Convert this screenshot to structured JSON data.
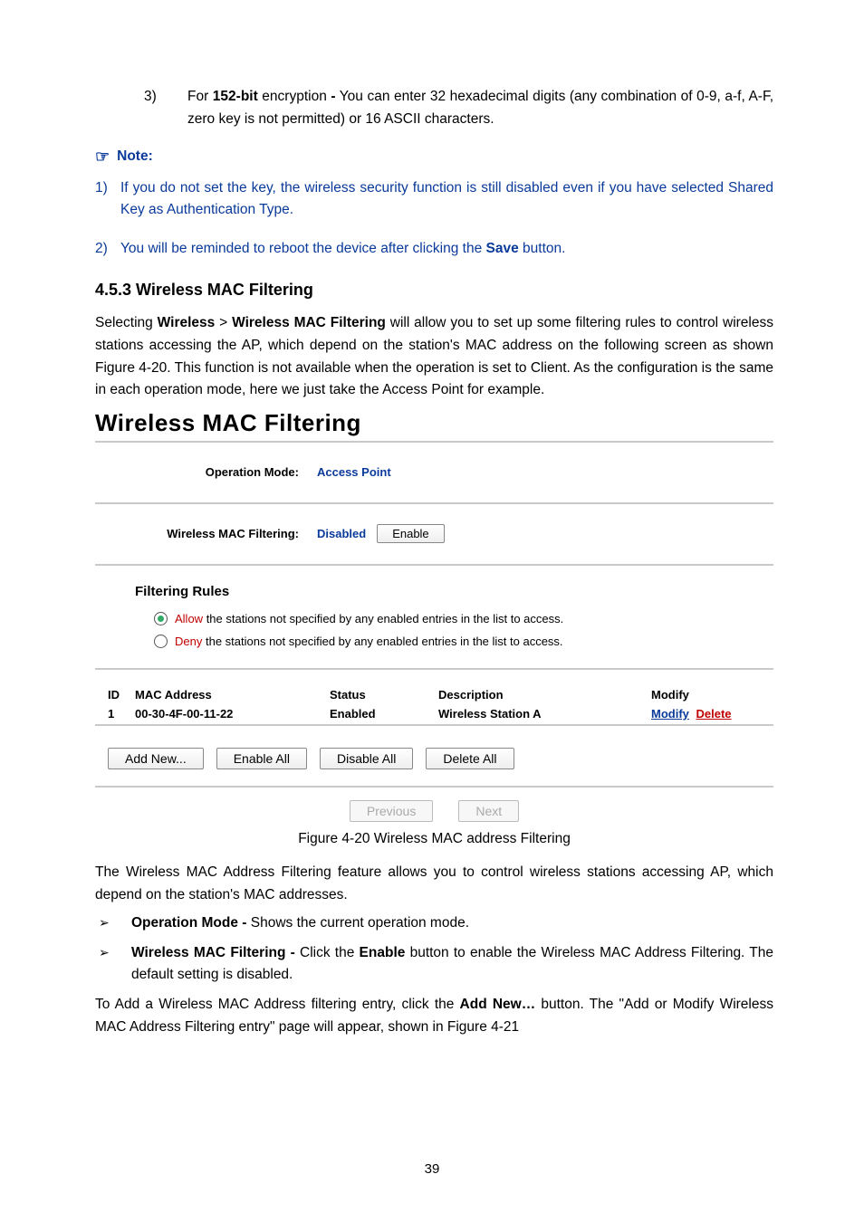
{
  "list_item_3": {
    "num": "3)",
    "prefix": "For ",
    "bold1": "152-bit",
    "mid1": " encryption ",
    "dash": "-",
    "rest": " You can enter 32 hexadecimal digits (any combination of 0-9, a-f, A-F, zero key is not permitted) or 16 ASCII characters."
  },
  "note": {
    "icon": "☞",
    "label": "Note:"
  },
  "note_items": [
    {
      "num": "1)",
      "text": "If you do not set the key, the wireless security function is still disabled even if you have selected Shared Key as Authentication Type."
    },
    {
      "num": "2)",
      "pre": "You will be reminded to reboot the device after clicking the ",
      "bold": "Save",
      "post": " button."
    }
  ],
  "section_heading": "4.5.3  Wireless MAC Filtering",
  "intro_para": {
    "p1a": "Selecting ",
    "b1": "Wireless",
    "sep": " > ",
    "b2": "Wireless MAC Filtering",
    "p1b": " will allow you to set up some filtering rules to control wireless stations accessing the AP, which depend on the station's MAC address on the following screen as shown Figure 4-20. This function is not available when the operation is set to Client. As the configuration is the same in each operation mode, here we just take the Access Point for example."
  },
  "panel_title": "Wireless MAC Filtering",
  "panel": {
    "op_mode_label": "Operation Mode:",
    "op_mode_value": "Access Point",
    "wmf_label": "Wireless MAC Filtering:",
    "wmf_value": "Disabled",
    "enable_btn": "Enable",
    "rules_head": "Filtering Rules",
    "rule_allow_word": "Allow",
    "rule_allow_rest": " the stations not specified by any enabled entries in the list to access.",
    "rule_deny_word": "Deny",
    "rule_deny_rest": " the stations not specified by any enabled entries in the list to access.",
    "table": {
      "head": {
        "id": "ID",
        "mac": "MAC Address",
        "status": "Status",
        "desc": "Description",
        "mod": "Modify"
      },
      "rows": [
        {
          "id": "1",
          "mac": "00-30-4F-00-11-22",
          "status": "Enabled",
          "desc": "Wireless Station A",
          "modify": "Modify",
          "delete": "Delete"
        }
      ]
    },
    "buttons": {
      "add": "Add New...",
      "enable_all": "Enable All",
      "disable_all": "Disable All",
      "delete_all": "Delete All"
    },
    "pager": {
      "prev": "Previous",
      "next": "Next"
    }
  },
  "caption": "Figure 4-20 Wireless MAC address Filtering",
  "after_para": "The Wireless MAC Address Filtering feature allows you to control wireless stations accessing AP, which depend on the station's MAC addresses.",
  "bullets": [
    {
      "bold": "Operation Mode -",
      "rest": " Shows the current operation mode."
    },
    {
      "bold": "Wireless MAC Filtering -",
      "mid": " Click the ",
      "bold2": "Enable",
      "rest": " button to enable the Wireless MAC Address Filtering. The default setting is disabled."
    }
  ],
  "final_para": {
    "p": "To Add a Wireless MAC Address filtering entry, click the ",
    "b": "Add New…",
    "p2": " button. The \"Add or Modify Wireless MAC Address Filtering entry\" page will appear, shown in Figure 4-21"
  },
  "page_number": "39"
}
